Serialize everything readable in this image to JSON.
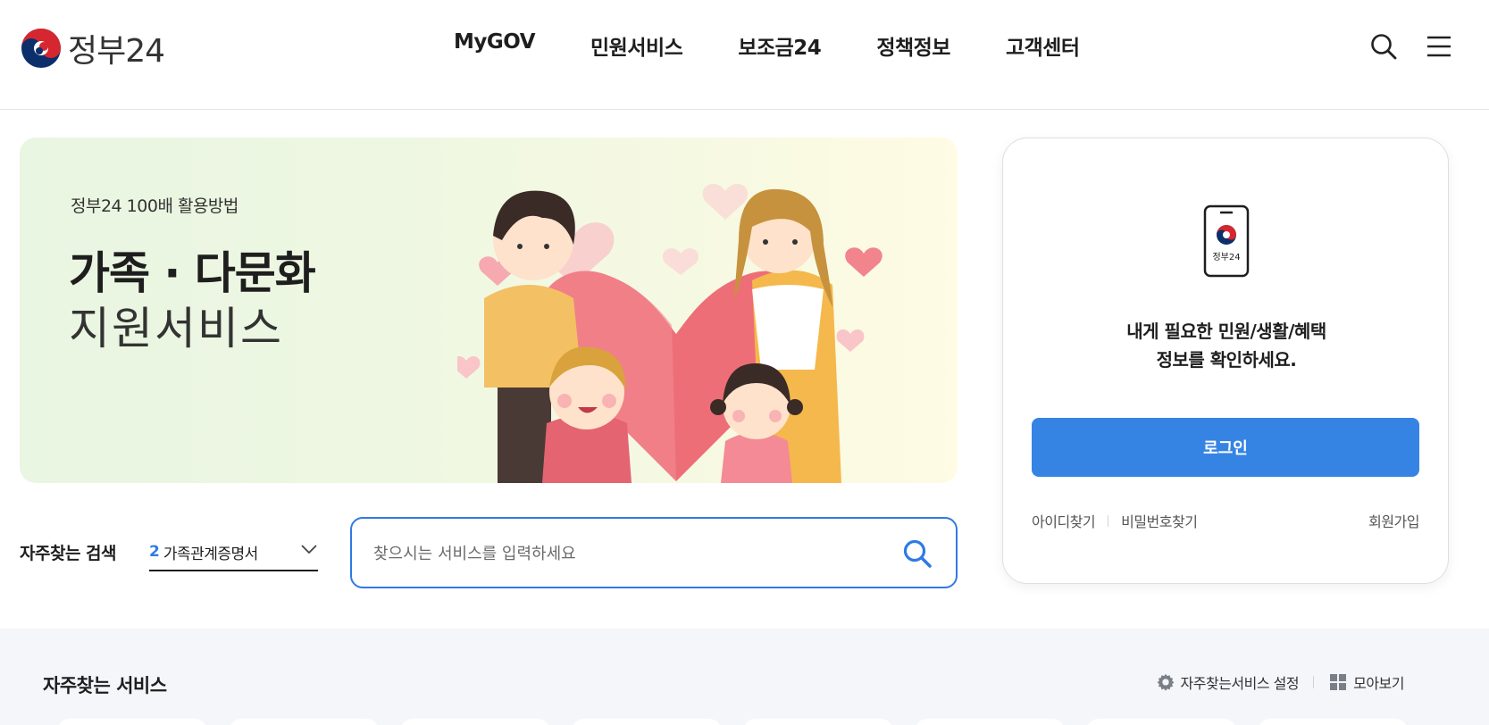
{
  "header": {
    "logo_text": "정부24",
    "nav": [
      "MyGOV",
      "민원서비스",
      "보조금24",
      "정책정보",
      "고객센터"
    ],
    "icons": [
      "search-icon",
      "menu-icon"
    ]
  },
  "banner": {
    "subtitle": "정부24 100배 활용방법",
    "title_line1": "가족 · 다문화",
    "title_line2": "지원서비스"
  },
  "frequent_search": {
    "label": "자주찾는 검색",
    "rank": "2",
    "value": "가족관계증명서"
  },
  "search": {
    "placeholder": "찾으시는 서비스를 입력하세요"
  },
  "login_card": {
    "phone_label": "정부24",
    "message_line1": "내게 필요한 민원/생활/혜택",
    "message_line2": "정보를 확인하세요.",
    "login_button": "로그인",
    "find_id": "아이디찾기",
    "find_password": "비밀번호찾기",
    "signup": "회원가입"
  },
  "services": {
    "title": "자주찾는 서비스",
    "settings_label": "자주찾는서비스 설정",
    "view_all_label": "모아보기"
  },
  "colors": {
    "accent": "#2f7ae5",
    "login_button": "#3584e4",
    "banner_bg": "#eef7e2",
    "section_bg": "#f4f6f9"
  }
}
